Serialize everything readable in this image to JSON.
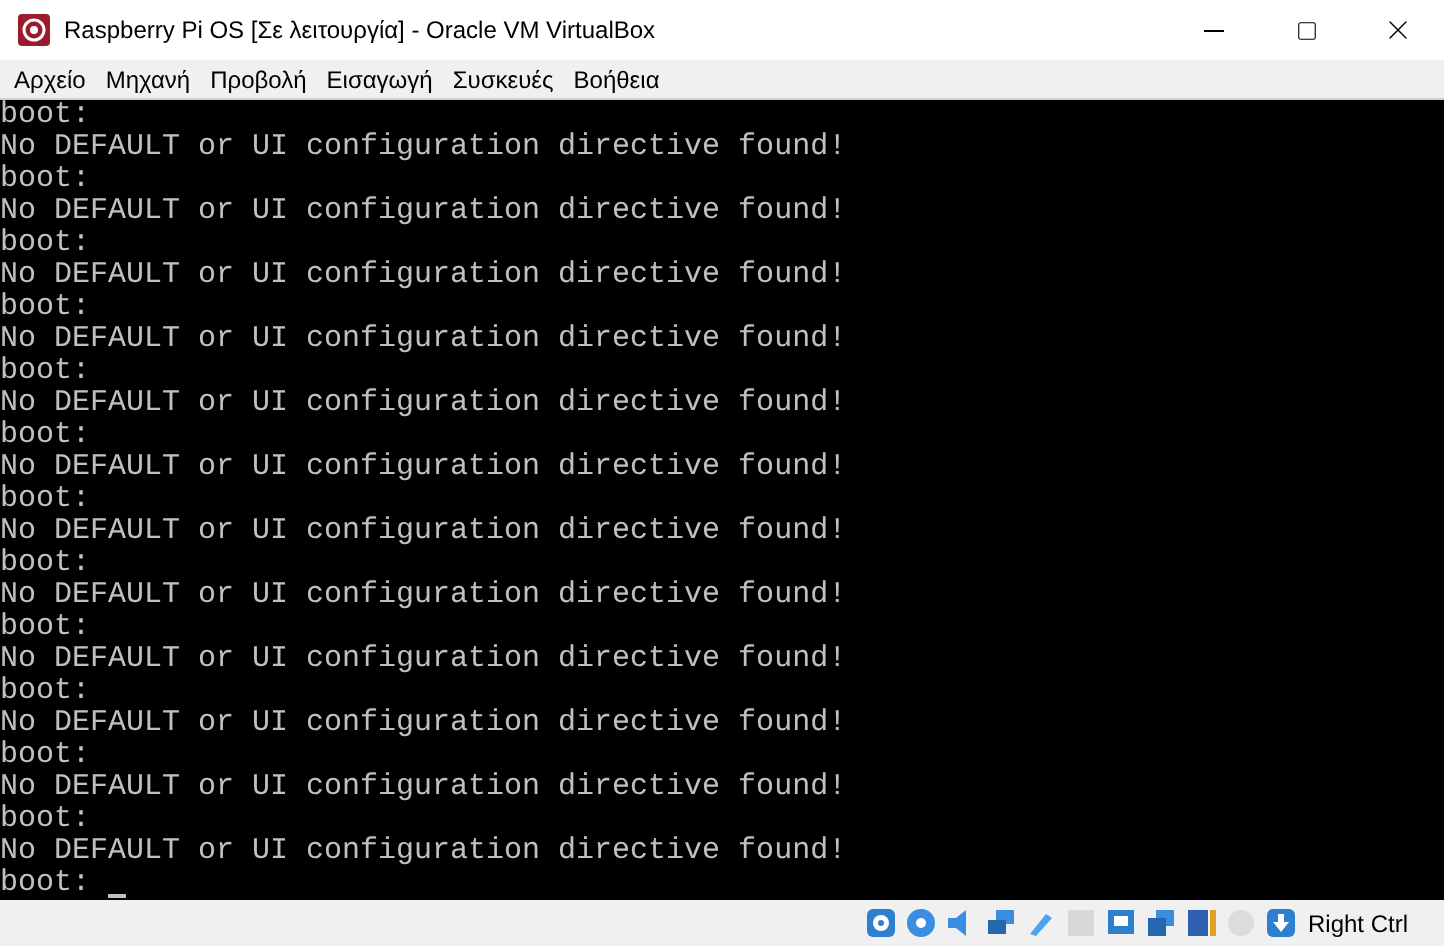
{
  "window": {
    "title": "Raspberry Pi OS [Σε λειτουργία] - Oracle VM VirtualBox"
  },
  "menu": [
    "Αρχείο",
    "Μηχανή",
    "Προβολή",
    "Εισαγωγή",
    "Συσκευές",
    "Βοήθεια"
  ],
  "console": {
    "lines": [
      "boot:",
      "No DEFAULT or UI configuration directive found!",
      "boot:",
      "No DEFAULT or UI configuration directive found!",
      "boot:",
      "No DEFAULT or UI configuration directive found!",
      "boot:",
      "No DEFAULT or UI configuration directive found!",
      "boot:",
      "No DEFAULT or UI configuration directive found!",
      "boot:",
      "No DEFAULT or UI configuration directive found!",
      "boot:",
      "No DEFAULT or UI configuration directive found!",
      "boot:",
      "No DEFAULT or UI configuration directive found!",
      "boot:",
      "No DEFAULT or UI configuration directive found!",
      "boot:",
      "No DEFAULT or UI configuration directive found!",
      "boot:",
      "No DEFAULT or UI configuration directive found!",
      "boot:",
      "No DEFAULT or UI configuration directive found!",
      "boot:"
    ],
    "cursor": true
  },
  "status_bar": {
    "host_key": "Right Ctrl"
  }
}
